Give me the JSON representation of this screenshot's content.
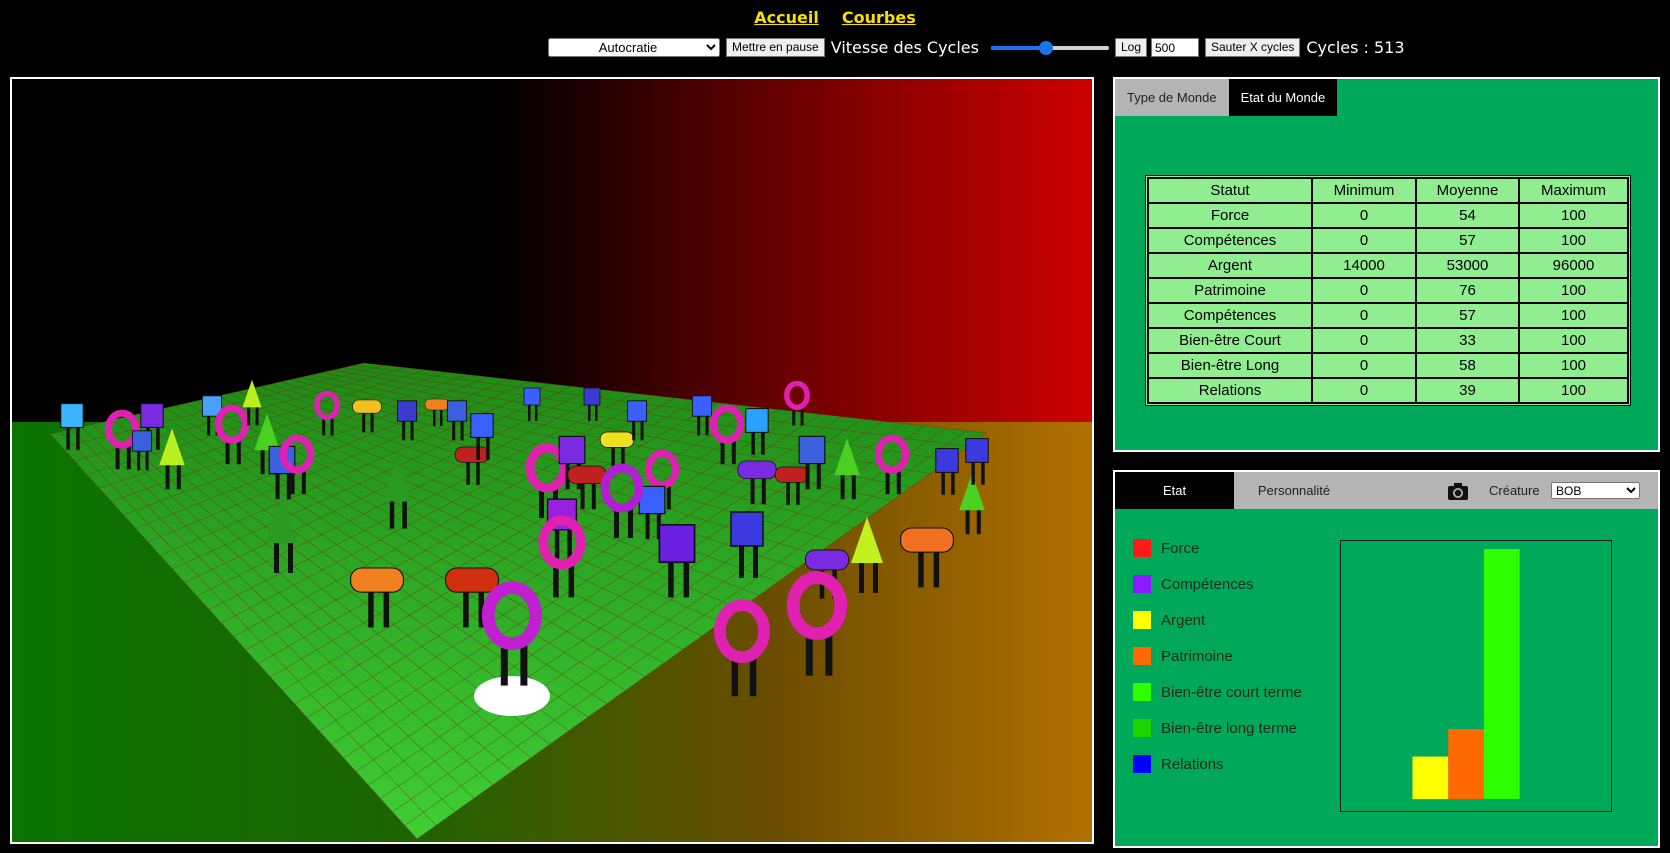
{
  "nav": {
    "home": "Accueil",
    "curves": "Courbes"
  },
  "controls": {
    "regime_selected": "Autocratie",
    "pause_label": "Mettre en pause",
    "speed_label": "Vitesse des Cycles",
    "speed_level": 0.47,
    "log_label": "Log",
    "skip_value": "500",
    "skip_label": "Sauter X cycles",
    "cycles_label": "Cycles : 513"
  },
  "world_panel": {
    "tabs": [
      "Type de Monde",
      "Etat du Monde"
    ],
    "active_tab": "Etat du Monde",
    "headers": [
      "Statut",
      "Minimum",
      "Moyenne",
      "Maximum"
    ],
    "rows": [
      [
        "Force",
        "0",
        "54",
        "100"
      ],
      [
        "Compétences",
        "0",
        "57",
        "100"
      ],
      [
        "Argent",
        "14000",
        "53000",
        "96000"
      ],
      [
        "Patrimoine",
        "0",
        "76",
        "100"
      ],
      [
        "Compétences",
        "0",
        "57",
        "100"
      ],
      [
        "Bien-être Court",
        "0",
        "33",
        "100"
      ],
      [
        "Bien-être Long",
        "0",
        "58",
        "100"
      ],
      [
        "Relations",
        "0",
        "39",
        "100"
      ]
    ]
  },
  "creature_panel": {
    "tabs": [
      "Etat",
      "Personnalité"
    ],
    "active_tab": "Etat",
    "creature_label": "Créature",
    "creature_selected": "BOB",
    "legend": [
      {
        "label": "Force",
        "color": "#ff1a1a"
      },
      {
        "label": "Compétences",
        "color": "#8a1aff"
      },
      {
        "label": "Argent",
        "color": "#ffff00"
      },
      {
        "label": "Patrimoine",
        "color": "#ff6a00"
      },
      {
        "label": "Bien-être court terme",
        "color": "#2dff00"
      },
      {
        "label": "Bien-être long terme",
        "color": "#1ed400"
      },
      {
        "label": "Relations",
        "color": "#0000ff"
      }
    ]
  },
  "chart_data": {
    "type": "bar",
    "categories": [
      "Force",
      "Compétences",
      "Argent",
      "Patrimoine",
      "Bien-être court terme",
      "Bien-être long terme",
      "Relations"
    ],
    "values": [
      0,
      0,
      17,
      28,
      100,
      0,
      0
    ],
    "colors": [
      "#ff1a1a",
      "#8a1aff",
      "#ffff00",
      "#ff6a00",
      "#2dff00",
      "#1ed400",
      "#0000ff"
    ],
    "ylim": [
      0,
      100
    ],
    "grid": false
  }
}
